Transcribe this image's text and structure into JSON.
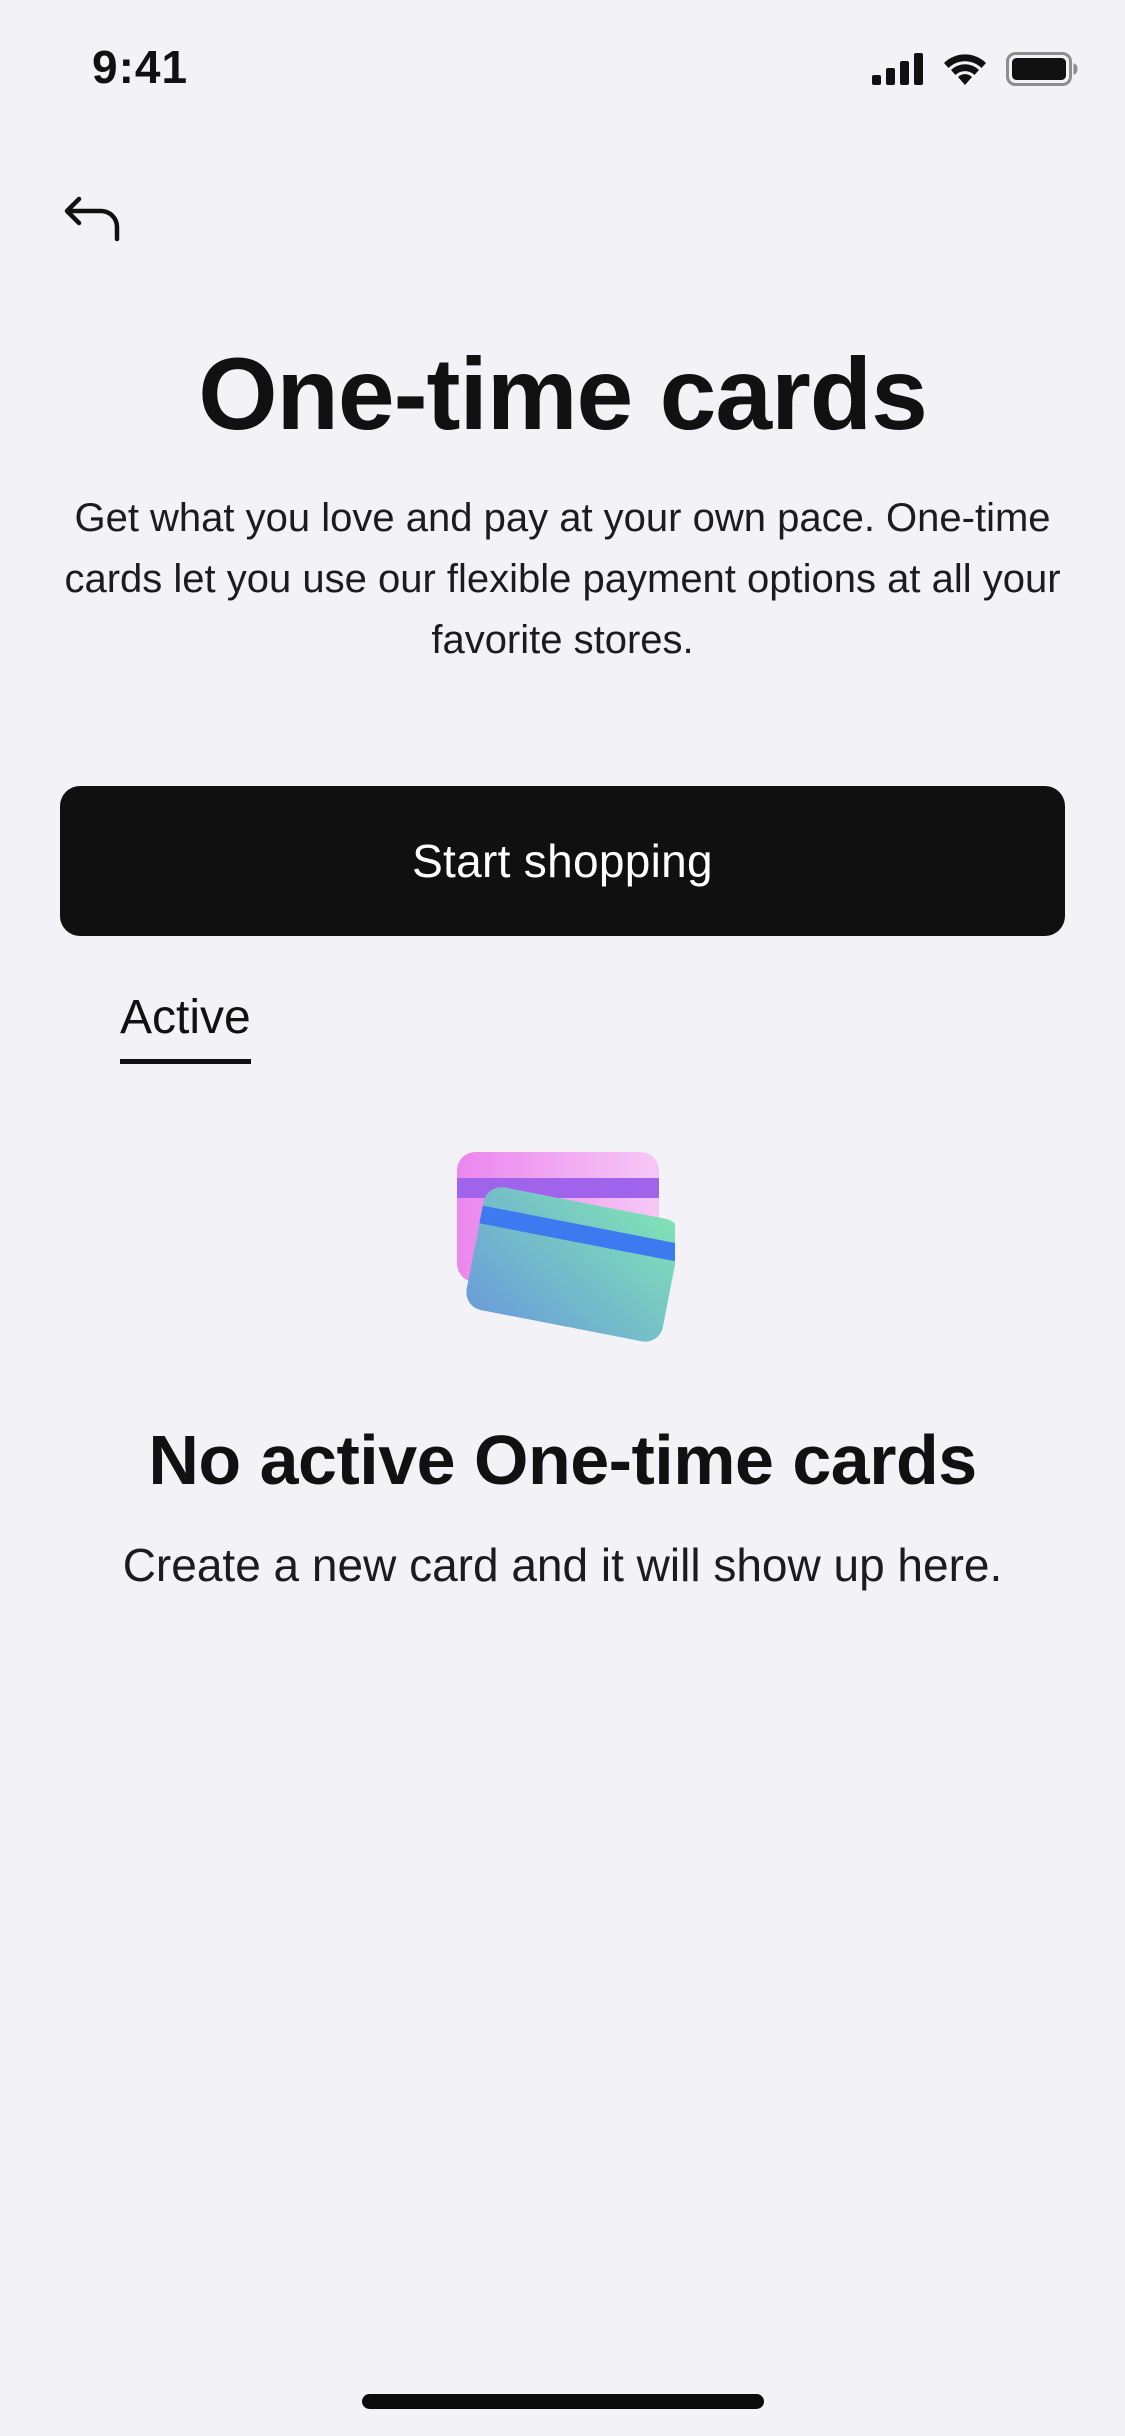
{
  "status_bar": {
    "time": "9:41",
    "icons": [
      "cellular-signal-icon",
      "wifi-icon",
      "battery-icon"
    ]
  },
  "nav": {
    "back_icon": "back-arrow-icon"
  },
  "header": {
    "title": "One-time cards",
    "description": "Get what you love and pay at your own pace. One-time cards let you use our flexible payment options at all your favorite stores."
  },
  "primary_button": {
    "label": "Start shopping"
  },
  "tabs": [
    {
      "label": "Active",
      "selected": true
    }
  ],
  "empty_state": {
    "illustration": "cards-illustration",
    "title": "No active One-time cards",
    "subtitle": "Create a new card and it will show up here."
  },
  "colors": {
    "background": "#F2F2F7",
    "button_bg": "#101011",
    "button_text": "#FFFFFF",
    "text": "#111111",
    "card_back_pink": "#EE8FF0",
    "card_back_stripe": "#A062E8",
    "card_front_blue": "#6FA4D8",
    "card_front_green": "#7EDDB8",
    "card_front_stripe": "#3F7BEE"
  }
}
